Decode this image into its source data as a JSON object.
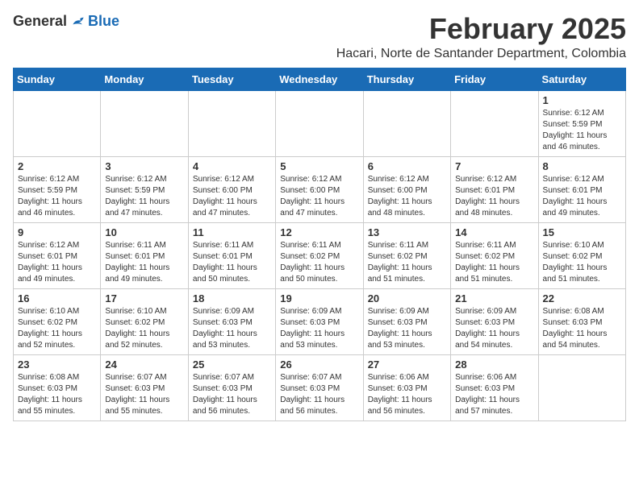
{
  "header": {
    "logo_general": "General",
    "logo_blue": "Blue",
    "title": "February 2025",
    "location": "Hacari, Norte de Santander Department, Colombia"
  },
  "weekdays": [
    "Sunday",
    "Monday",
    "Tuesday",
    "Wednesday",
    "Thursday",
    "Friday",
    "Saturday"
  ],
  "weeks": [
    [
      {
        "day": "",
        "info": ""
      },
      {
        "day": "",
        "info": ""
      },
      {
        "day": "",
        "info": ""
      },
      {
        "day": "",
        "info": ""
      },
      {
        "day": "",
        "info": ""
      },
      {
        "day": "",
        "info": ""
      },
      {
        "day": "1",
        "info": "Sunrise: 6:12 AM\nSunset: 5:59 PM\nDaylight: 11 hours\nand 46 minutes."
      }
    ],
    [
      {
        "day": "2",
        "info": "Sunrise: 6:12 AM\nSunset: 5:59 PM\nDaylight: 11 hours\nand 46 minutes."
      },
      {
        "day": "3",
        "info": "Sunrise: 6:12 AM\nSunset: 5:59 PM\nDaylight: 11 hours\nand 47 minutes."
      },
      {
        "day": "4",
        "info": "Sunrise: 6:12 AM\nSunset: 6:00 PM\nDaylight: 11 hours\nand 47 minutes."
      },
      {
        "day": "5",
        "info": "Sunrise: 6:12 AM\nSunset: 6:00 PM\nDaylight: 11 hours\nand 47 minutes."
      },
      {
        "day": "6",
        "info": "Sunrise: 6:12 AM\nSunset: 6:00 PM\nDaylight: 11 hours\nand 48 minutes."
      },
      {
        "day": "7",
        "info": "Sunrise: 6:12 AM\nSunset: 6:01 PM\nDaylight: 11 hours\nand 48 minutes."
      },
      {
        "day": "8",
        "info": "Sunrise: 6:12 AM\nSunset: 6:01 PM\nDaylight: 11 hours\nand 49 minutes."
      }
    ],
    [
      {
        "day": "9",
        "info": "Sunrise: 6:12 AM\nSunset: 6:01 PM\nDaylight: 11 hours\nand 49 minutes."
      },
      {
        "day": "10",
        "info": "Sunrise: 6:11 AM\nSunset: 6:01 PM\nDaylight: 11 hours\nand 49 minutes."
      },
      {
        "day": "11",
        "info": "Sunrise: 6:11 AM\nSunset: 6:01 PM\nDaylight: 11 hours\nand 50 minutes."
      },
      {
        "day": "12",
        "info": "Sunrise: 6:11 AM\nSunset: 6:02 PM\nDaylight: 11 hours\nand 50 minutes."
      },
      {
        "day": "13",
        "info": "Sunrise: 6:11 AM\nSunset: 6:02 PM\nDaylight: 11 hours\nand 51 minutes."
      },
      {
        "day": "14",
        "info": "Sunrise: 6:11 AM\nSunset: 6:02 PM\nDaylight: 11 hours\nand 51 minutes."
      },
      {
        "day": "15",
        "info": "Sunrise: 6:10 AM\nSunset: 6:02 PM\nDaylight: 11 hours\nand 51 minutes."
      }
    ],
    [
      {
        "day": "16",
        "info": "Sunrise: 6:10 AM\nSunset: 6:02 PM\nDaylight: 11 hours\nand 52 minutes."
      },
      {
        "day": "17",
        "info": "Sunrise: 6:10 AM\nSunset: 6:02 PM\nDaylight: 11 hours\nand 52 minutes."
      },
      {
        "day": "18",
        "info": "Sunrise: 6:09 AM\nSunset: 6:03 PM\nDaylight: 11 hours\nand 53 minutes."
      },
      {
        "day": "19",
        "info": "Sunrise: 6:09 AM\nSunset: 6:03 PM\nDaylight: 11 hours\nand 53 minutes."
      },
      {
        "day": "20",
        "info": "Sunrise: 6:09 AM\nSunset: 6:03 PM\nDaylight: 11 hours\nand 53 minutes."
      },
      {
        "day": "21",
        "info": "Sunrise: 6:09 AM\nSunset: 6:03 PM\nDaylight: 11 hours\nand 54 minutes."
      },
      {
        "day": "22",
        "info": "Sunrise: 6:08 AM\nSunset: 6:03 PM\nDaylight: 11 hours\nand 54 minutes."
      }
    ],
    [
      {
        "day": "23",
        "info": "Sunrise: 6:08 AM\nSunset: 6:03 PM\nDaylight: 11 hours\nand 55 minutes."
      },
      {
        "day": "24",
        "info": "Sunrise: 6:07 AM\nSunset: 6:03 PM\nDaylight: 11 hours\nand 55 minutes."
      },
      {
        "day": "25",
        "info": "Sunrise: 6:07 AM\nSunset: 6:03 PM\nDaylight: 11 hours\nand 56 minutes."
      },
      {
        "day": "26",
        "info": "Sunrise: 6:07 AM\nSunset: 6:03 PM\nDaylight: 11 hours\nand 56 minutes."
      },
      {
        "day": "27",
        "info": "Sunrise: 6:06 AM\nSunset: 6:03 PM\nDaylight: 11 hours\nand 56 minutes."
      },
      {
        "day": "28",
        "info": "Sunrise: 6:06 AM\nSunset: 6:03 PM\nDaylight: 11 hours\nand 57 minutes."
      },
      {
        "day": "",
        "info": ""
      }
    ]
  ]
}
